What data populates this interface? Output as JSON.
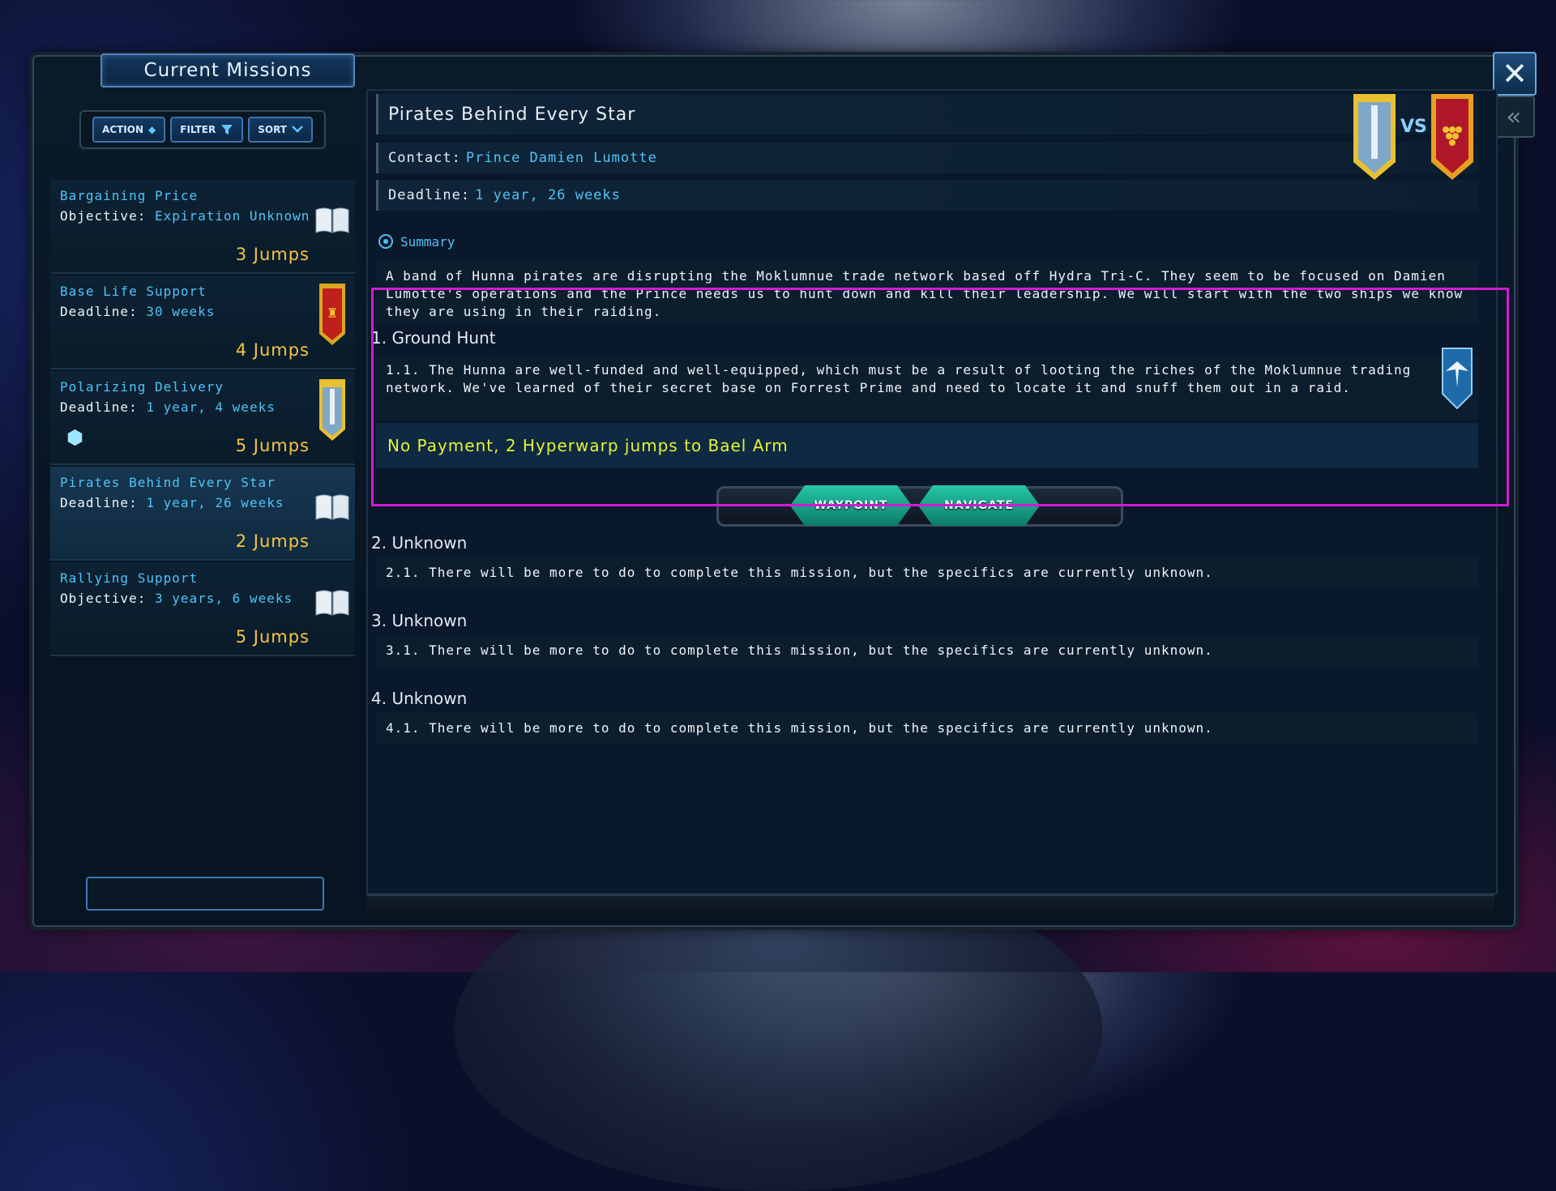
{
  "window": {
    "title": "Current Missions",
    "close_label": "✕",
    "back_label": "«"
  },
  "toolbar": {
    "action_label": "ACTION",
    "filter_label": "FILTER",
    "sort_label": "SORT"
  },
  "missions": [
    {
      "name": "Bargaining Price",
      "label": "Objective:",
      "value": "Expiration Unknown",
      "jumps": "3 Jumps",
      "icon": "book-icon"
    },
    {
      "name": "Base Life Support",
      "label": "Deadline:",
      "value": "30 weeks",
      "jumps": "4 Jumps",
      "icon": "red-lion-banner-icon"
    },
    {
      "name": "Polarizing Delivery",
      "label": "Deadline:",
      "value": "1 year, 4 weeks",
      "jumps": "5 Jumps",
      "icon": "yellow-blue-banner-icon",
      "cube_icon": "cargo-cube-icon"
    },
    {
      "name": "Pirates Behind Every Star",
      "label": "Deadline:",
      "value": "1 year, 26 weeks",
      "jumps": "2 Jumps",
      "icon": "book-icon",
      "selected": true
    },
    {
      "name": "Rallying Support",
      "label": "Objective:",
      "value": "3 years, 6 weeks",
      "jumps": "5 Jumps",
      "icon": "book-icon"
    }
  ],
  "detail": {
    "title": "Pirates Behind Every Star",
    "contact_label": "Contact:",
    "contact_value": "Prince Damien Lumotte",
    "deadline_label": "Deadline:",
    "deadline_value": "1 year, 26 weeks",
    "vs_label": "VS",
    "summary_label": "Summary",
    "summary_text": "A band of Hunna pirates are disrupting the Moklumnue trade network based off Hydra Tri-C. They seem to be focused on Damien Lumotte's operations and the Prince needs us to hunt down and kill their leadership. We will start with the two ships we know they are using in their raiding.",
    "steps": [
      {
        "title": "1. Ground Hunt",
        "text": "1.1. The Hunna are well-funded and well-equipped, which must be a result of looting the riches of the Moklumnue trading network. We've learned of their secret base on Forrest Prime and need to locate it and snuff them out in a raid."
      },
      {
        "title": "2. Unknown",
        "text": "2.1. There will be more to do to complete this mission, but the specifics are currently unknown."
      },
      {
        "title": "3. Unknown",
        "text": "3.1. There will be more to do to complete this mission, but the specifics are currently unknown."
      },
      {
        "title": "4. Unknown",
        "text": "4.1. There will be more to do to complete this mission, but the specifics are currently unknown."
      }
    ],
    "payment_text": "No Payment, 2 Hyperwarp jumps to Bael Arm",
    "waypoint_label": "WAYPOINT",
    "navigate_label": "NAVIGATE"
  },
  "colors": {
    "accent_cyan": "#4fc3f7",
    "jumps_gold": "#f5c542",
    "payment_yellow": "#e6f13a",
    "highlight_magenta": "#d21ad2"
  }
}
